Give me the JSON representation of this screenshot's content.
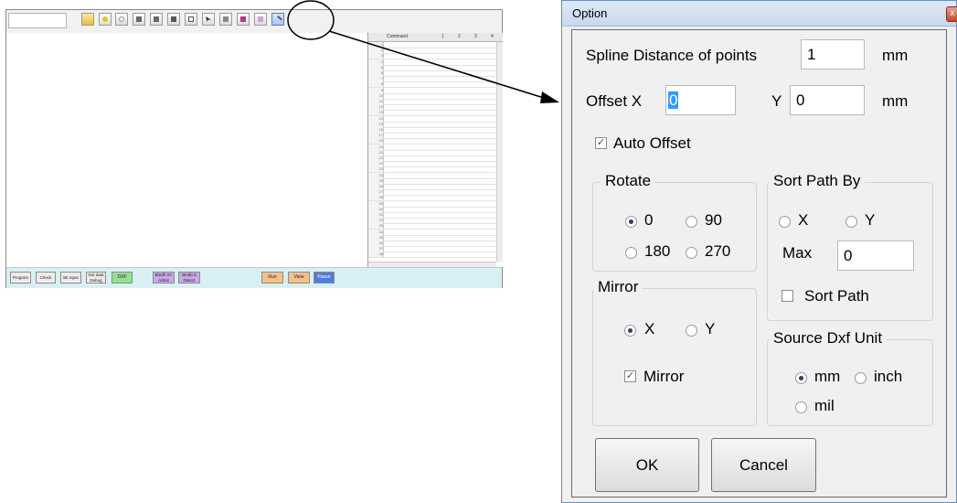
{
  "app": {
    "grid": {
      "headers": [
        "",
        "Command",
        "1",
        "2",
        "3",
        "4"
      ],
      "rows": [
        "1",
        "2",
        "3",
        "4",
        "5",
        "6",
        "7",
        "8",
        "9",
        "10",
        "11",
        "12",
        "13",
        "14",
        "15",
        "16",
        "17",
        "18",
        "19",
        "20",
        "21",
        "22",
        "23",
        "24",
        "25",
        "26",
        "27",
        "28",
        "29",
        "30",
        "31",
        "32",
        "33",
        "34",
        "35",
        "36",
        "37",
        "38"
      ]
    },
    "bottom_buttons": [
      {
        "label": "Program",
        "color": "gray"
      },
      {
        "label": "Check",
        "color": "gray"
      },
      {
        "label": "Bit Input",
        "color": "gray"
      },
      {
        "label": "Dot data Debug",
        "color": "gray"
      },
      {
        "label": "DXF",
        "color": "green"
      },
      {
        "label": "Bindb XY Admit",
        "color": "purple"
      },
      {
        "label": "Bindb Z Detect",
        "color": "purple"
      },
      {
        "label": "Run",
        "color": "orange"
      },
      {
        "label": "View",
        "color": "orange"
      },
      {
        "label": "Pause",
        "color": "blue"
      }
    ],
    "toolbar_icons": [
      "folder-icon",
      "bulb-on-icon",
      "bulb-off-icon",
      "zoom-in-icon",
      "zoom-out-icon",
      "fit-icon",
      "frame-icon",
      "pointer-icon",
      "delete-icon",
      "grid-icon",
      "shape-icon",
      "dxf-option-icon"
    ]
  },
  "dialog": {
    "title": "Option",
    "spline_label": "Spline Distance of points",
    "spline_value": "1",
    "spline_unit": "mm",
    "offset_x_label": "Offset X",
    "offset_x_value": "0",
    "offset_y_label": "Y",
    "offset_y_value": "0",
    "offset_unit": "mm",
    "auto_offset_label": "Auto Offset",
    "auto_offset_checked": true,
    "rotate": {
      "legend": "Rotate",
      "options": [
        "0",
        "90",
        "180",
        "270"
      ],
      "selected": "0"
    },
    "mirror": {
      "legend": "Mirror",
      "options": [
        "X",
        "Y"
      ],
      "selected": "X",
      "check_label": "Mirror",
      "checked": true
    },
    "sort_path": {
      "legend": "Sort Path By",
      "options": [
        "X",
        "Y"
      ],
      "selected": null,
      "max_label": "Max",
      "max_value": "0",
      "check_label": "Sort Path",
      "checked": false
    },
    "source_unit": {
      "legend": "Source Dxf Unit",
      "options": [
        "mm",
        "inch",
        "mil"
      ],
      "selected": "mm"
    },
    "ok_label": "OK",
    "cancel_label": "Cancel",
    "close_glyph": "x"
  },
  "colors": {
    "titlebar": "#c7d8ee",
    "dialog_bg": "#f0f0f0",
    "bottom_bar": "#d8f0f4",
    "selection": "#3399ff"
  }
}
